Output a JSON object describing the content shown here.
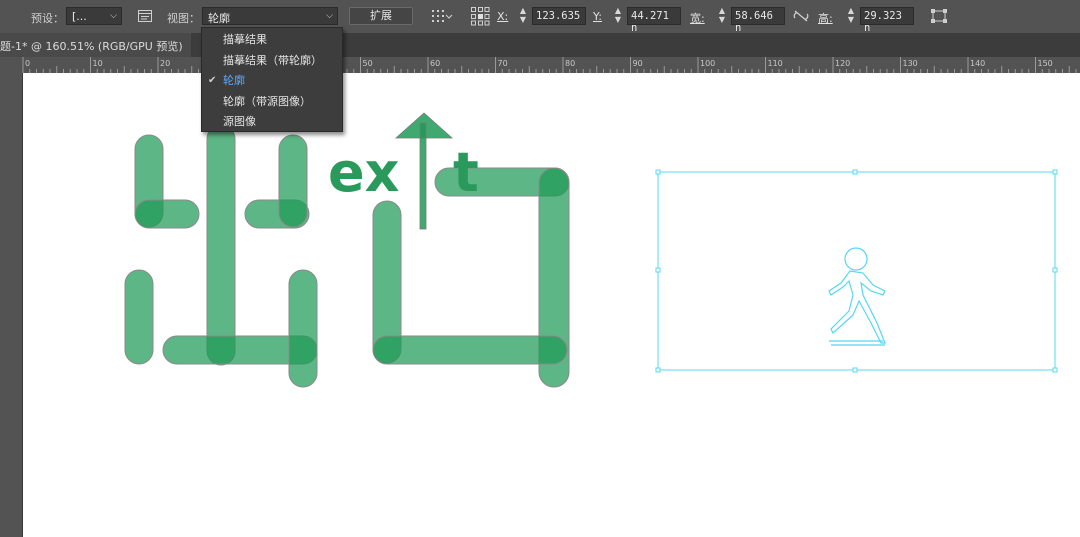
{
  "toolbar": {
    "preset_label": "预设：",
    "preset_value": "[...",
    "view_label": "视图：",
    "view_value": "轮廓",
    "expand_button": "扩展",
    "x_label": "X:",
    "x_value": "123.635",
    "y_label": "Y:",
    "y_value": "44.271 n",
    "w_label": "宽:",
    "w_value": "58.646 n",
    "h_label": "高:",
    "h_value": "29.323 n"
  },
  "document_tab": {
    "title": "题-1* @ 160.51% (RGB/GPU 预览)"
  },
  "ruler": {
    "labels": [
      "0",
      "10",
      "20",
      "30",
      "40",
      "50",
      "60",
      "70",
      "80",
      "90",
      "100",
      "110",
      "120",
      "130",
      "140",
      "150"
    ]
  },
  "view_menu": {
    "items": [
      {
        "label": "描摹结果",
        "selected": false
      },
      {
        "label": "描摹结果（带轮廓）",
        "selected": false
      },
      {
        "label": "轮廓",
        "selected": true
      },
      {
        "label": "轮廓（带源图像）",
        "selected": false
      },
      {
        "label": "源图像",
        "selected": false
      }
    ],
    "check_glyph": "✔"
  },
  "artwork": {
    "exit_text_left": "ex",
    "exit_text_right": "t",
    "green_color": "#1f9a56",
    "outline_color": "#56d8ef"
  }
}
